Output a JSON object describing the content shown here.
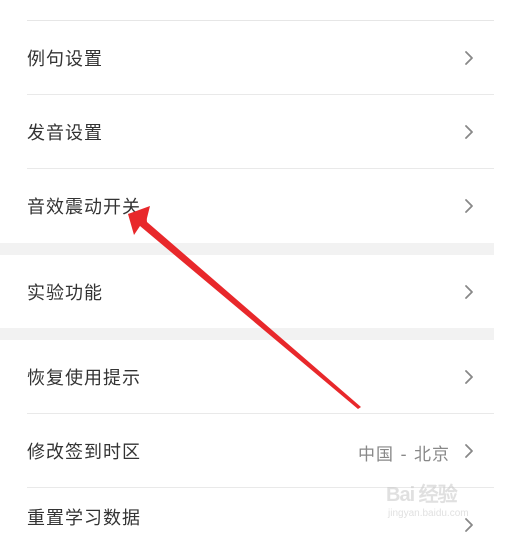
{
  "settings": {
    "rows": [
      {
        "label": "例句设置"
      },
      {
        "label": "发音设置"
      },
      {
        "label": "音效震动开关"
      },
      {
        "label": "实验功能"
      },
      {
        "label": "恢复使用提示"
      },
      {
        "label": "修改签到时区",
        "value": "中国 - 北京"
      },
      {
        "label": "重置学习数据"
      }
    ]
  },
  "watermark": {
    "brand": "Bai 经验",
    "site": "jingyan.baidu.com"
  },
  "icons": {
    "chevron": "chevron-right-icon",
    "annotation": "red-arrow-annotation"
  },
  "colors": {
    "arrow": "#e8282b",
    "text": "#333333",
    "secondary": "#888888",
    "section_gap": "#f2f2f2"
  }
}
